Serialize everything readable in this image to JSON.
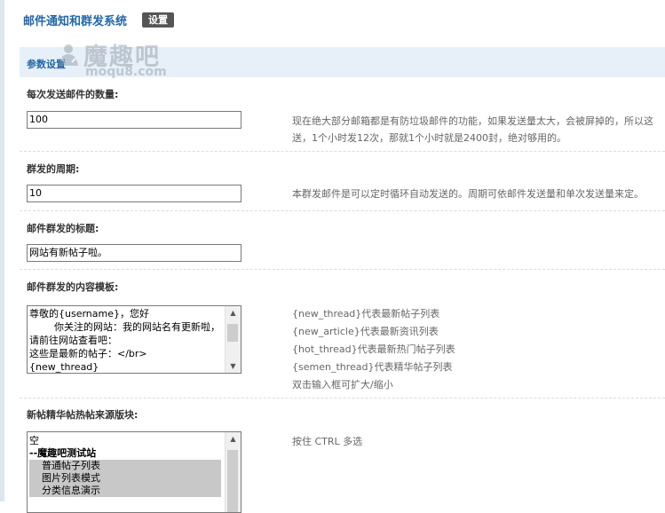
{
  "app": {
    "title": "邮件通知和群发系统",
    "settings_label": "设置"
  },
  "watermark": {
    "text": "魔趣吧",
    "url": "moqu8.com"
  },
  "section": {
    "title": "参数设置"
  },
  "fields": {
    "per_send": {
      "label": "每次发送邮件的数量:",
      "value": "100",
      "tip_line1": "现在绝大部分邮箱都是有防垃圾邮件的功能，如果发送量太大，会被屏掉的，所以这",
      "tip_line2": "送，1个小时发12次，那就1个小时就是2400封，绝对够用的。"
    },
    "cycle": {
      "label": "群发的周期:",
      "value": "10",
      "tip": "本群发邮件是可以定时循环自动发送的。周期可依邮件发送量和单次发送量来定。"
    },
    "subject": {
      "label": "邮件群发的标题:",
      "value": "网站有新帖子啦。"
    },
    "template": {
      "label": "邮件群发的内容模板:",
      "value": "尊敬的{username}，您好\n        你关注的网站：我的网站名有更新啦，请前往网站查看吧：\n这些是最新的帖子：</br>\n{new_thread}",
      "tips": [
        "{new_thread}代表最新帖子列表",
        "{new_article}代表最新资讯列表",
        "{hot_thread}代表最新热门帖子列表",
        "{semen_thread}代表精华帖子列表",
        "双击输入框可扩大/缩小"
      ]
    },
    "source_forums": {
      "label": "新帖精华帖热帖来源版块:",
      "tip": "按住 CTRL 多选",
      "options": [
        {
          "text": "空",
          "selected": false,
          "bold": false
        },
        {
          "text": "--魔趣吧测试站",
          "selected": false,
          "bold": true
        },
        {
          "text": "    普通帖子列表",
          "selected": true,
          "bold": false
        },
        {
          "text": "    图片列表模式",
          "selected": true,
          "bold": false
        },
        {
          "text": "    分类信息演示",
          "selected": true,
          "bold": false
        }
      ]
    }
  }
}
